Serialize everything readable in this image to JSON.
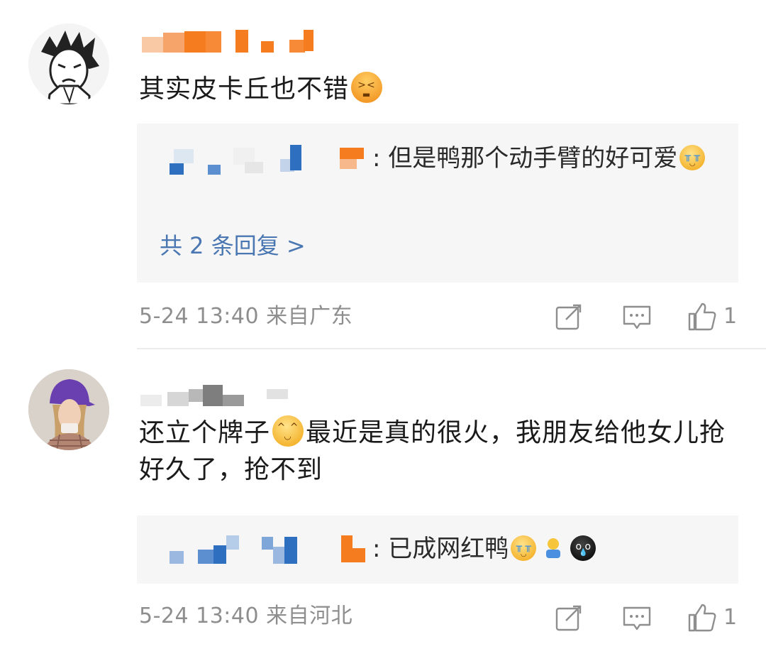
{
  "comments": [
    {
      "username": "",
      "text_parts": [
        "其实皮卡丘也不错"
      ],
      "emojis": [
        "grimacing-face"
      ],
      "reply_preview": {
        "reply_user": "",
        "text": "但是鸭那个动手臂的好可爱",
        "emojis": [
          "loudly-crying-face"
        ],
        "more_replies_label": "共 2 条回复 >"
      },
      "date": "5-24 13:40",
      "location": "来自广东",
      "like_count": "1",
      "icons": [
        "share-icon",
        "comment-icon",
        "like-icon"
      ]
    },
    {
      "username": "",
      "text_part1": "还立个牌子",
      "text_part2": "最近是真的很火，我朋友给他女儿抢好久了，抢不到",
      "emojis": [
        "laughing-with-tears-face"
      ],
      "reply_preview": {
        "reply_user": "",
        "text": "已成网红鸭",
        "emojis": [
          "loudly-crying-face",
          "kid-icon",
          "dark-crying-face"
        ]
      },
      "date": "5-24 13:40",
      "location": "来自河北",
      "like_count": "1",
      "icons": [
        "share-icon",
        "comment-icon",
        "like-icon"
      ]
    }
  ],
  "colors": {
    "link_blue": "#4a77b2",
    "meta_gray": "#8e8e8e",
    "reply_bg": "#f6f6f6",
    "mosaic_orange": "#f57c1f",
    "mosaic_blue": "#2e6fbf"
  }
}
